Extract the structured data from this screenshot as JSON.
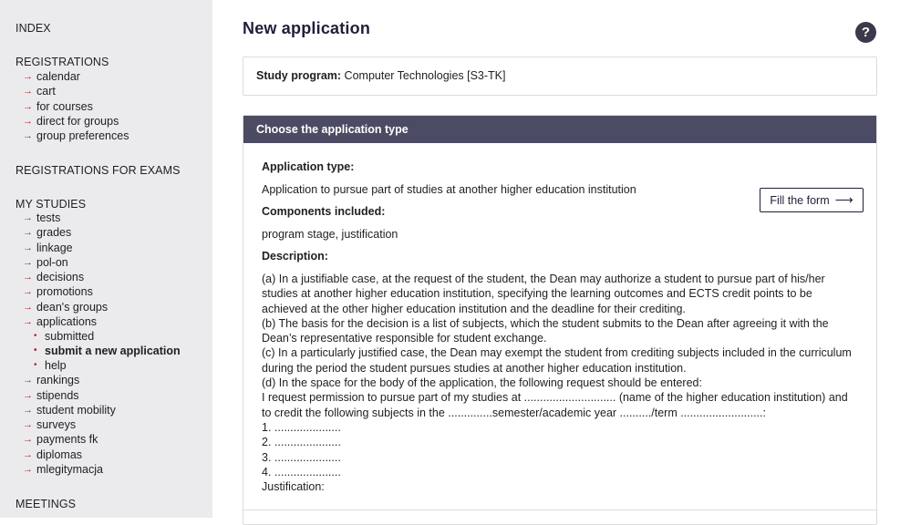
{
  "sidebar": {
    "index": "INDEX",
    "registrations": {
      "title": "REGISTRATIONS",
      "items": [
        "calendar",
        "cart",
        "for courses",
        "direct for groups",
        "group preferences"
      ]
    },
    "exams": "REGISTRATIONS FOR EXAMS",
    "my_studies": {
      "title": "MY STUDIES",
      "items_before": [
        "tests",
        "grades",
        "linkage",
        "pol-on",
        "decisions",
        "promotions",
        "dean's groups",
        "applications"
      ],
      "sub_items": [
        "submitted",
        "submit a new application",
        "help"
      ],
      "active_sub": "submit a new application",
      "items_after": [
        "rankings",
        "stipends",
        "student mobility",
        "surveys",
        "payments fk",
        "diplomas",
        "mlegitymacja"
      ]
    },
    "meetings": "MEETINGS",
    "arrow_icon": "arrow-right-icon",
    "accent_color": "#c0272d"
  },
  "main": {
    "title": "New application",
    "help_label": "?",
    "program": {
      "label": "Study program:",
      "value": "Computer Technologies [S3-TK]"
    },
    "panel": {
      "header": "Choose the application type",
      "header_color": "#4b4b63",
      "type_label": "Application type:",
      "type_value": "Application to pursue part of studies at another higher education institution",
      "components_label": "Components included:",
      "components_value": "program stage,  justification",
      "description_label": "Description:",
      "description_lines": [
        "(a) In a justifiable case, at the request of the student, the Dean may authorize a student to pursue part of his/her",
        "studies at another higher education institution, specifying the learning outcomes and ECTS credit points to be",
        "achieved at the other higher education institution and the deadline for their crediting.",
        "(b) The basis for the decision is a list of subjects, which the student submits to the Dean after agreeing it with the",
        "Dean’s representative responsible for student exchange.",
        "(c) In a particularly justified case, the Dean may exempt the student from crediting subjects included in the curriculum",
        "during the period the student pursues studies at another higher education institution.",
        "(d) In the space for the body of the application, the following request should be entered:",
        "I request permission to pursue part of my studies at ............................. (name of the higher education institution) and",
        "to credit the following subjects in the ..............semester/academic year ........../term ..........................:",
        "1. .....................",
        "2. .....................",
        "3. .....................",
        "4. .....................",
        "Justification:"
      ],
      "fill_button": "Fill the form"
    }
  }
}
